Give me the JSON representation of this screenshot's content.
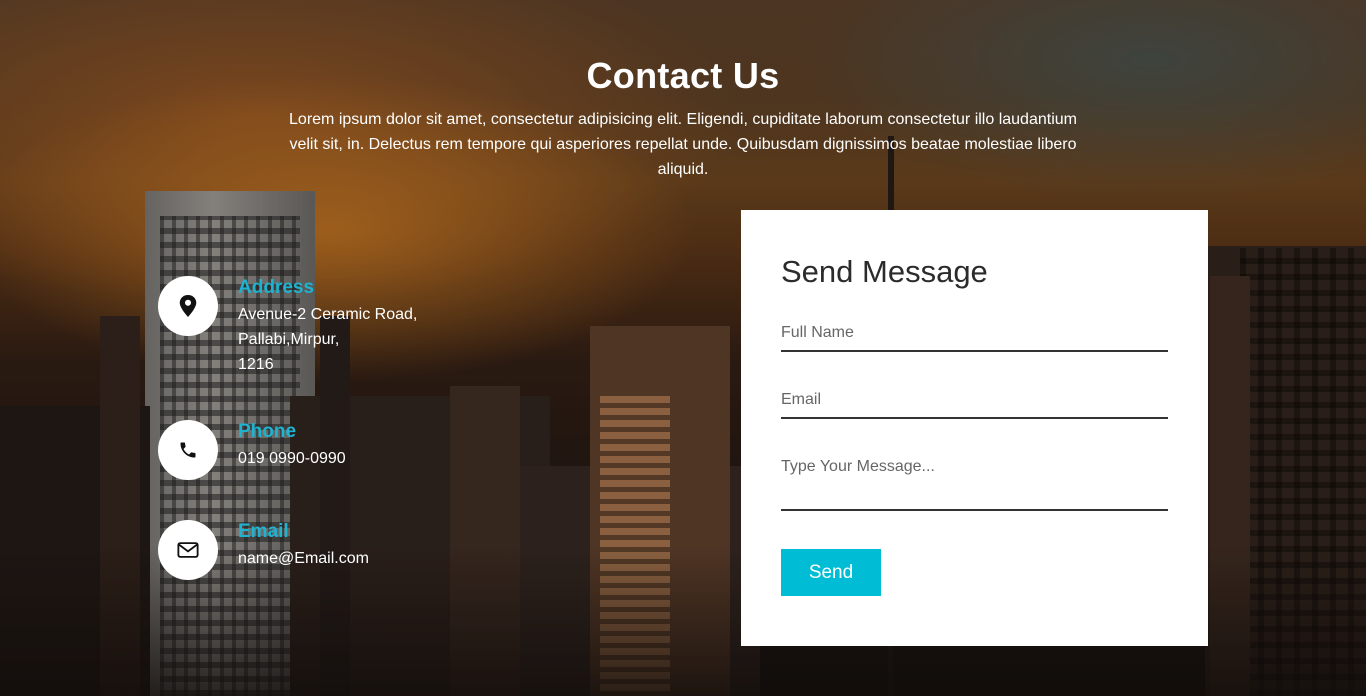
{
  "header": {
    "title": "Contact Us",
    "intro": "Lorem ipsum dolor sit amet, consectetur adipisicing elit. Eligendi, cupiditate laborum consectetur illo laudantium velit sit, in. Delectus rem tempore qui asperiores repellat unde. Quibusdam dignissimos beatae molestiae libero aliquid."
  },
  "contact_info": [
    {
      "icon": "map-pin-icon",
      "label": "Address",
      "lines": [
        "Avenue-2 Ceramic Road,",
        "Pallabi,Mirpur,",
        "1216"
      ]
    },
    {
      "icon": "phone-icon",
      "label": "Phone",
      "lines": [
        "019 0990-0990"
      ]
    },
    {
      "icon": "envelope-icon",
      "label": "Email",
      "lines": [
        "name@Email.com"
      ]
    }
  ],
  "form": {
    "title": "Send Message",
    "full_name_placeholder": "Full Name",
    "email_placeholder": "Email",
    "message_placeholder": "Type Your Message...",
    "submit_label": "Send"
  },
  "colors": {
    "accent": "#00bcd4",
    "label": "#1db3d1",
    "card": "#ffffff"
  }
}
